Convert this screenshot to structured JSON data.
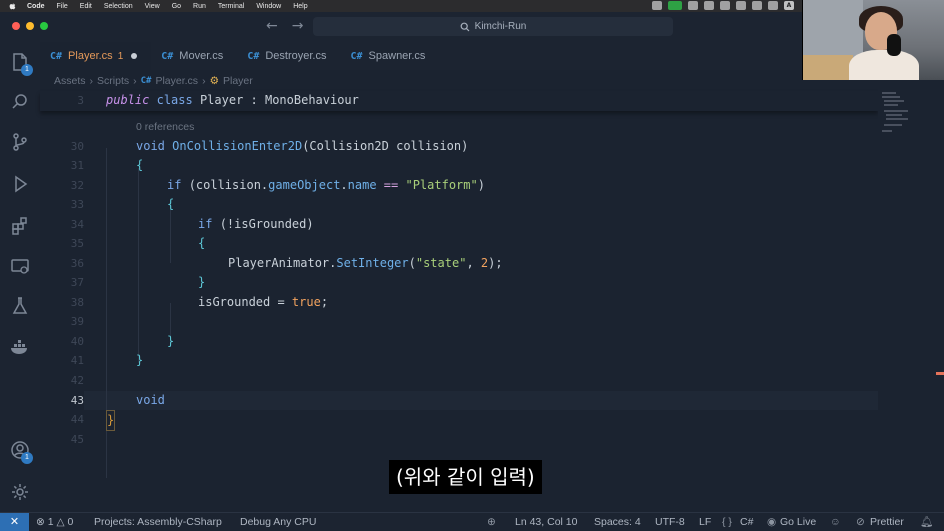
{
  "menubar": {
    "app": "Code",
    "items": [
      "File",
      "Edit",
      "Selection",
      "View",
      "Go",
      "Run",
      "Terminal",
      "Window",
      "Help"
    ],
    "tray_letter": "A"
  },
  "titlebar": {
    "command_center": "Kimchi-Run"
  },
  "activity": {
    "explorer_badge": "1",
    "accounts_badge": "1"
  },
  "tabs": [
    {
      "label": "Player.cs",
      "modified_count": "1",
      "active": true
    },
    {
      "label": "Mover.cs"
    },
    {
      "label": "Destroyer.cs"
    },
    {
      "label": "Spawner.cs"
    }
  ],
  "breadcrumb": [
    "Assets",
    "Scripts",
    "Player.cs",
    "Player"
  ],
  "editor": {
    "codelens": "0 references",
    "sticky": {
      "ln": "3",
      "kw1": "public",
      "kw2": "class",
      "rest": " Player : MonoBehaviour"
    },
    "lines": [
      {
        "n": "30"
      },
      {
        "n": "31"
      },
      {
        "n": "32"
      },
      {
        "n": "33"
      },
      {
        "n": "34"
      },
      {
        "n": "35"
      },
      {
        "n": "36"
      },
      {
        "n": "37"
      },
      {
        "n": "38"
      },
      {
        "n": "39"
      },
      {
        "n": "40"
      },
      {
        "n": "41"
      },
      {
        "n": "42"
      },
      {
        "n": "43"
      },
      {
        "n": "44"
      },
      {
        "n": "45"
      }
    ],
    "tokens": {
      "void": "void",
      "method": "OnCollisionEnter2D",
      "params": "(Collision2D collision)",
      "open": "{",
      "close": "}",
      "if": "if",
      "cond_a": "(collision.",
      "gameObject": "gameObject",
      "dot": ".",
      "name": "name",
      "eq": " == ",
      "platform": "\"Platform\"",
      "paren_close": ")",
      "not_grounded": "(!isGrounded)",
      "animator": "PlayerAnimator.",
      "setint": "SetInteger",
      "paren_open": "(",
      "state": "\"state\"",
      "comma": ", ",
      "two": "2",
      "end": ");",
      "assign": "isGrounded = ",
      "true": "true",
      "semi": ";"
    }
  },
  "subtitle": "(위와 같이 입력)",
  "status": {
    "remote": "✕",
    "problems": "⊗ 1 △ 0",
    "project": "Projects: Assembly-CSharp",
    "debug": "Debug Any CPU",
    "position": "Ln 43, Col 10",
    "spaces": "Spaces: 4",
    "encoding": "UTF-8",
    "eol": "LF",
    "language": "C#",
    "golive": "Go Live",
    "prettier": "Prettier"
  }
}
